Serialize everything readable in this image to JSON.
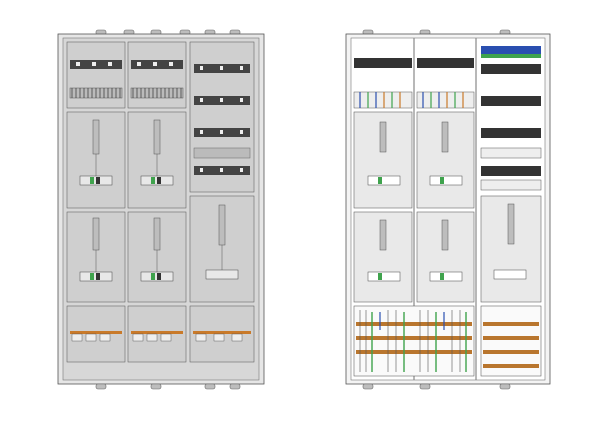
{
  "image": {
    "description_free": true,
    "views": [
      {
        "id": "closed",
        "name": "front-closed-view"
      },
      {
        "id": "open",
        "name": "front-open-view"
      }
    ]
  },
  "colors": {
    "background": "#ffffff",
    "cabinet_frame": "#d9d9d9",
    "panel_gray": "#c9c9c9",
    "panel_dark": "#9a9a9a",
    "outline": "#555555",
    "open_interior": "#ffffff",
    "breaker_black": "#222222",
    "terminal_orange": "#c97a2a",
    "terminal_green": "#3fa34d",
    "terminal_blue": "#2a4fb0",
    "terminal_yellow": "#d6c23a",
    "busbar_copper": "#b9762e"
  }
}
